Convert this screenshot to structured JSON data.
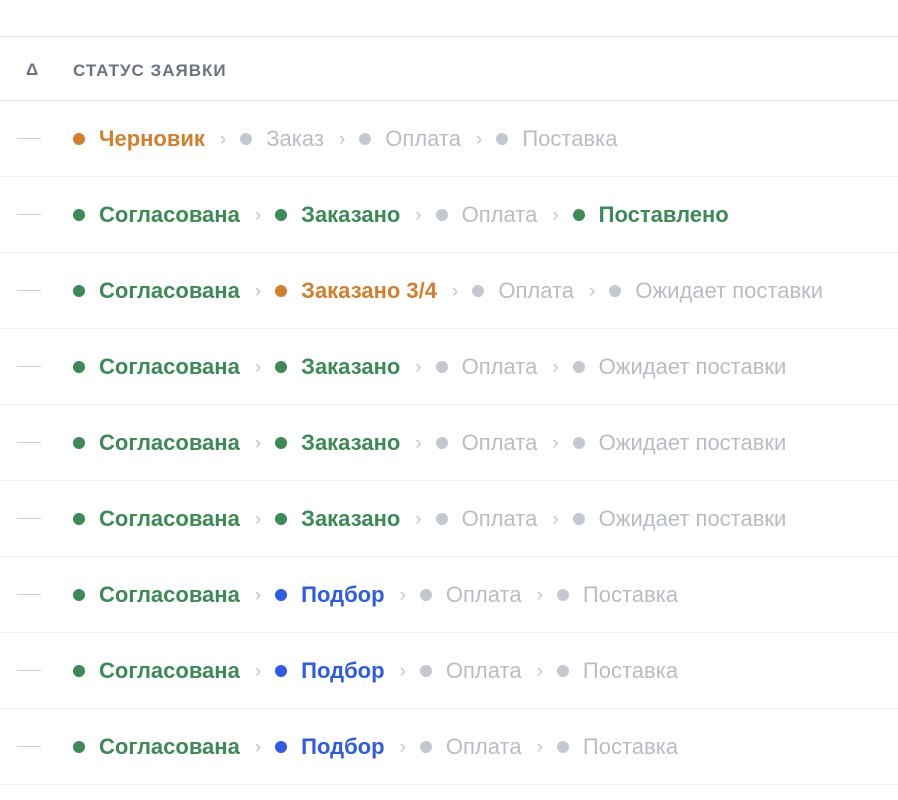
{
  "colors": {
    "done": "#3c8a55",
    "partial": "#d27f2c",
    "active": "#2f5be6",
    "pending": "#c4c8d0"
  },
  "table": {
    "headers": {
      "delta": "Δ",
      "status": "СТАТУС ЗАЯВКИ"
    },
    "separator": "›",
    "delta_placeholder": "—",
    "rows": [
      {
        "steps": [
          {
            "label": "Черновик",
            "state": "orange"
          },
          {
            "label": "Заказ",
            "state": "gray"
          },
          {
            "label": "Оплата",
            "state": "gray"
          },
          {
            "label": "Поставка",
            "state": "gray"
          }
        ]
      },
      {
        "steps": [
          {
            "label": "Согласована",
            "state": "green"
          },
          {
            "label": "Заказано",
            "state": "green"
          },
          {
            "label": "Оплата",
            "state": "gray"
          },
          {
            "label": "Поставлено",
            "state": "green"
          }
        ]
      },
      {
        "steps": [
          {
            "label": "Согласована",
            "state": "green"
          },
          {
            "label": "Заказано 3/4",
            "state": "orange"
          },
          {
            "label": "Оплата",
            "state": "gray"
          },
          {
            "label": "Ожидает поставки",
            "state": "gray"
          }
        ]
      },
      {
        "steps": [
          {
            "label": "Согласована",
            "state": "green"
          },
          {
            "label": "Заказано",
            "state": "green"
          },
          {
            "label": "Оплата",
            "state": "gray"
          },
          {
            "label": "Ожидает поставки",
            "state": "gray"
          }
        ]
      },
      {
        "steps": [
          {
            "label": "Согласована",
            "state": "green"
          },
          {
            "label": "Заказано",
            "state": "green"
          },
          {
            "label": "Оплата",
            "state": "gray"
          },
          {
            "label": "Ожидает поставки",
            "state": "gray"
          }
        ]
      },
      {
        "steps": [
          {
            "label": "Согласована",
            "state": "green"
          },
          {
            "label": "Заказано",
            "state": "green"
          },
          {
            "label": "Оплата",
            "state": "gray"
          },
          {
            "label": "Ожидает поставки",
            "state": "gray"
          }
        ]
      },
      {
        "steps": [
          {
            "label": "Согласована",
            "state": "green"
          },
          {
            "label": "Подбор",
            "state": "blue"
          },
          {
            "label": "Оплата",
            "state": "gray"
          },
          {
            "label": "Поставка",
            "state": "gray"
          }
        ]
      },
      {
        "steps": [
          {
            "label": "Согласована",
            "state": "green"
          },
          {
            "label": "Подбор",
            "state": "blue"
          },
          {
            "label": "Оплата",
            "state": "gray"
          },
          {
            "label": "Поставка",
            "state": "gray"
          }
        ]
      },
      {
        "steps": [
          {
            "label": "Согласована",
            "state": "green"
          },
          {
            "label": "Подбор",
            "state": "blue"
          },
          {
            "label": "Оплата",
            "state": "gray"
          },
          {
            "label": "Поставка",
            "state": "gray"
          }
        ]
      }
    ]
  }
}
